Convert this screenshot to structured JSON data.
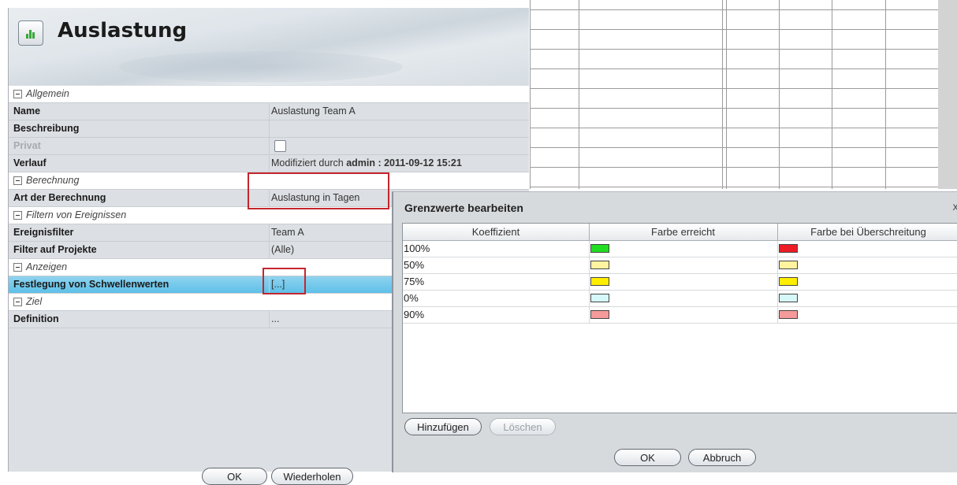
{
  "panel": {
    "title": "Auslastung",
    "rows": [
      {
        "type": "group",
        "label": "Allgemein"
      },
      {
        "type": "prop",
        "label": "Name",
        "value": "Auslastung Team A"
      },
      {
        "type": "prop",
        "label": "Beschreibung",
        "value": ""
      },
      {
        "type": "prop",
        "label": "Privat",
        "checkbox": true,
        "disabled": true
      },
      {
        "type": "prop",
        "label": "Verlauf",
        "value": "Modifiziert durch ",
        "value_bold": "admin : 2011-09-12 15:21"
      },
      {
        "type": "group",
        "label": "Berechnung"
      },
      {
        "type": "prop",
        "label": "Art der Berechnung",
        "value": "Auslastung in Tagen"
      },
      {
        "type": "group",
        "label": "Filtern von Ereignissen"
      },
      {
        "type": "prop",
        "label": "Ereignisfilter",
        "value": "Team A"
      },
      {
        "type": "prop",
        "label": "Filter auf  Projekte",
        "value": "(Alle)"
      },
      {
        "type": "group",
        "label": "Anzeigen"
      },
      {
        "type": "prop",
        "label": "Festlegung von Schwellenwerten",
        "value": "[...]",
        "selected": true
      },
      {
        "type": "group",
        "label": "Ziel"
      },
      {
        "type": "prop",
        "label": "Definition",
        "value": "..."
      }
    ],
    "ok_label": "OK",
    "repeat_label": "Wiederholen"
  },
  "dialog": {
    "title": "Grenzwerte bearbeiten",
    "close": "x",
    "columns": [
      "Koeffizient",
      "Farbe erreicht",
      "Farbe bei Überschreitung"
    ],
    "rows": [
      {
        "coef": "100%",
        "reached": "#22dd22",
        "exceeded": "#ee1c24"
      },
      {
        "coef": "50%",
        "reached": "#fff3a0",
        "exceeded": "#fff3a0"
      },
      {
        "coef": "75%",
        "reached": "#ffee00",
        "exceeded": "#ffee00"
      },
      {
        "coef": "0%",
        "reached": "#d6f8f8",
        "exceeded": "#d6f8f8"
      },
      {
        "coef": "90%",
        "reached": "#f49a9a",
        "exceeded": "#f49a9a"
      }
    ],
    "add_label": "Hinzufügen",
    "delete_label": "Löschen",
    "ok_label": "OK",
    "cancel_label": "Abbruch"
  }
}
